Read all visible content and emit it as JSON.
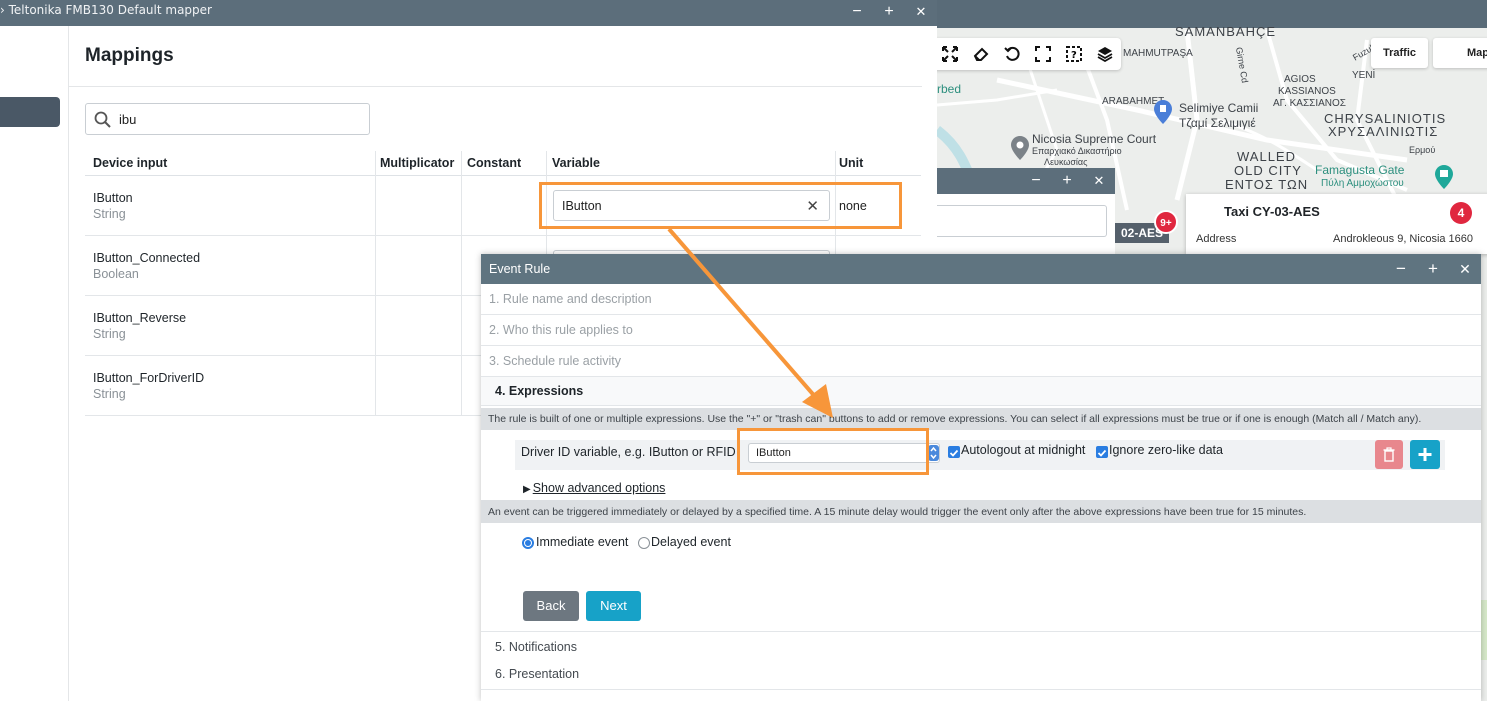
{
  "mapper_window": {
    "title": "› Teltonika FMB130 Default mapper",
    "controls": {
      "minimize": "−",
      "maximize": "+",
      "close": "✕"
    }
  },
  "mappings": {
    "title": "Mappings",
    "search": {
      "value": "ibu"
    },
    "columns": [
      "Device input",
      "Multiplicator",
      "Constant",
      "Variable",
      "Unit"
    ],
    "rows": [
      {
        "name": "IButton",
        "type": "String",
        "variable": "IButton",
        "unit": "none"
      },
      {
        "name": "IButton_Connected",
        "type": "Boolean",
        "variable": "",
        "unit": ""
      },
      {
        "name": "IButton_Reverse",
        "type": "String",
        "variable": "",
        "unit": ""
      },
      {
        "name": "IButton_ForDriverID",
        "type": "String",
        "variable": "",
        "unit": ""
      }
    ]
  },
  "map": {
    "traffic_label": "Traffic",
    "map_label": "Map",
    "labels": {
      "samanbahce": "SAMANBAHÇE",
      "mahmutpasa": "MAHMUTPAŞA",
      "fuzuli": "Fuzuli Sk",
      "yeni": "YENİ",
      "agios": "AGIOS",
      "kassianos": "KASSIANOS",
      "ag_kassianos": "ΑΓ. ΚΑΣΣΙΑΝΟΣ",
      "arabahmet": "ARABAHMET",
      "selimiye": "Selimiye Camii",
      "selimiye_gr": "Τζαμί Σελιμιγιέ",
      "chrysaliniotis": "CHRYSALINIOTIS",
      "chrysaliniotis_gr": "ΧΡΥΣΑΛΙΝΙΩΤΙΣ",
      "supreme_court": "Nicosia Supreme Court",
      "supreme_court_gr": "Επαρχιακό Δικαστήριο",
      "supreme_court_gr2": "Λευκωσίας",
      "walled": "WALLED",
      "old_city": "OLD CITY",
      "entos": "ΕΝΤΟΣ ΤΩΝ",
      "famagusta": "Famagusta Gate",
      "famagusta_gr": "Πύλη Αμμοχώστου",
      "ermou": "Ερμού",
      "bed": "rbed",
      "girne": "Girne Cd",
      "plate": "02-AES"
    },
    "badge": "9+",
    "taxi_card": {
      "title": "Taxi CY-03-AES",
      "count": "4",
      "address_label": "Address",
      "address_value": "Androkleous 9, Nicosia 1660"
    }
  },
  "event_rule": {
    "title": "Event Rule",
    "steps": [
      "1. Rule name and description",
      "2. Who this rule applies to",
      "3. Schedule rule activity",
      "4. Expressions",
      "5. Notifications",
      "6. Presentation"
    ],
    "expressions_info": "The rule is built of one or multiple expressions. Use the \"+\" or \"trash can\" buttons to add or remove expressions. You can select if all expressions must be true or if one is enough (Match all / Match any).",
    "expression": {
      "label": "Driver ID variable, e.g. IButton or RFID",
      "selected": "IButton",
      "autologout": "Autologout at midnight",
      "ignore_zero": "Ignore zero-like data"
    },
    "advanced": "Show advanced options",
    "delay_info": "An event can be triggered immediately or delayed by a specified time. A 15 minute delay would trigger the event only after the above expressions have been true for 15 minutes.",
    "immediate": "Immediate event",
    "delayed": "Delayed event",
    "back": "Back",
    "next": "Next"
  },
  "colors": {
    "accent": "#17a2c8",
    "highlight": "#f7963a",
    "titlebar": "#5c6e7b"
  }
}
